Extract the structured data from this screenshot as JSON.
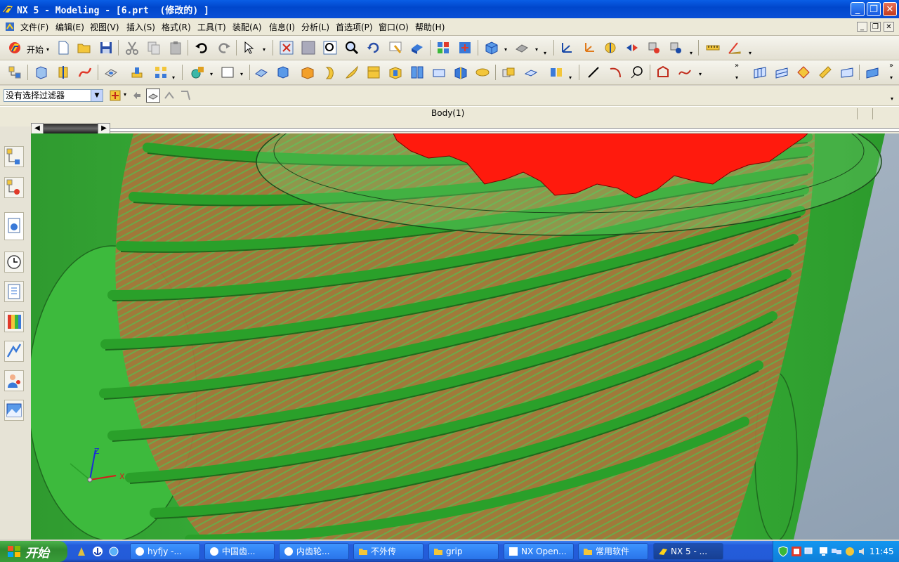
{
  "window": {
    "title": "NX 5 - Modeling - [6.prt  (修改的) ]",
    "controls": [
      "_",
      "□",
      "×"
    ]
  },
  "menu": [
    "文件(F)",
    "编辑(E)",
    "视图(V)",
    "插入(S)",
    "格式(R)",
    "工具(T)",
    "装配(A)",
    "信息(I)",
    "分析(L)",
    "首选项(P)",
    "窗口(O)",
    "帮助(H)"
  ],
  "toolbar": {
    "start_label": "开始"
  },
  "filter": {
    "value": "没有选择过滤器"
  },
  "selection": {
    "label": "Body(1)"
  },
  "axes": {
    "x": "X",
    "z": "Z"
  },
  "colors": {
    "worm": "#3cb83c",
    "gear": "#ff1a0d",
    "teeth": "#a6733a",
    "title_bar": "#0047cc",
    "taskbar": "#245ddb"
  },
  "taskbar": {
    "start": "开始",
    "buttons": [
      "hyfjy -...",
      "中国齿...",
      "内齿轮...",
      "不外传",
      "grip",
      "NX Open...",
      "常用软件",
      "NX 5 - ..."
    ],
    "active_index": 7,
    "clock": "11:45"
  }
}
